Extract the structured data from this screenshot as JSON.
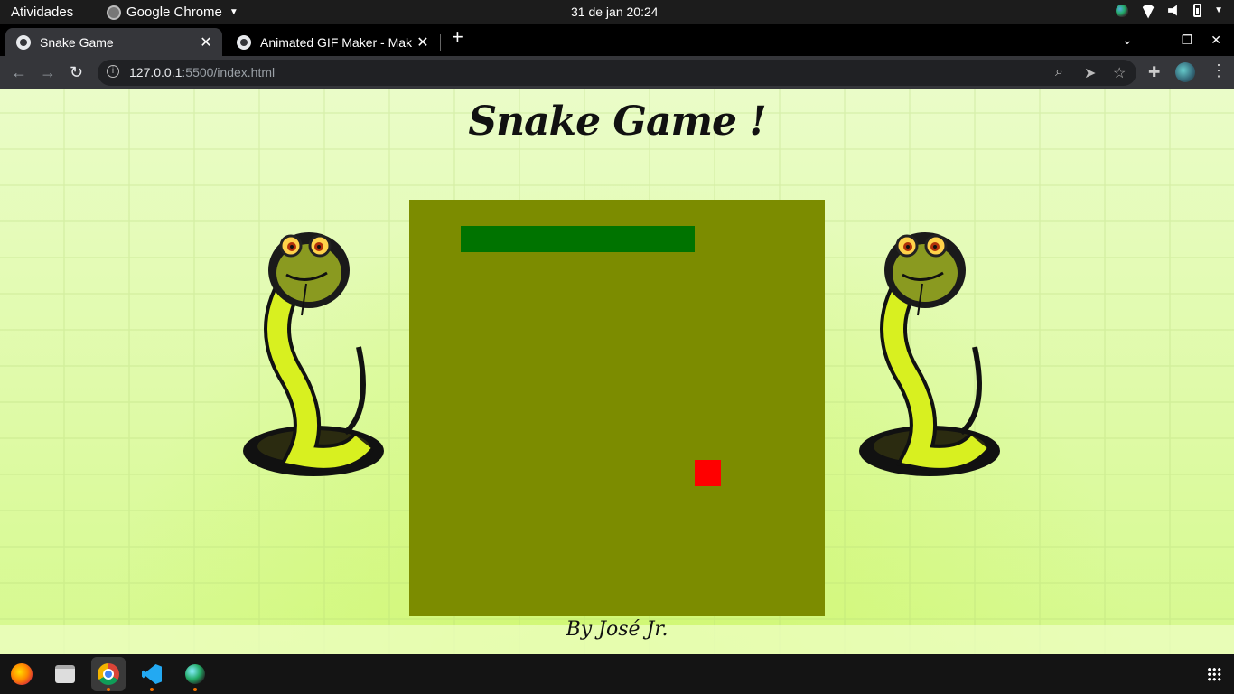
{
  "topbar": {
    "activities": "Atividades",
    "app_name": "Google Chrome",
    "clock": "31 de jan  20:24"
  },
  "tabs": [
    {
      "title": "Snake Game",
      "active": true
    },
    {
      "title": "Animated GIF Maker - Mak",
      "active": false
    }
  ],
  "address_bar": {
    "host": "127.0.0.1",
    "path": ":5500/index.html"
  },
  "page": {
    "heading": "Snake Game !",
    "byline": "By José Jr."
  },
  "game": {
    "board_color": "#7c8c00",
    "snake_color": "#007300",
    "food_color": "#ff0000"
  },
  "dock": {
    "items": [
      "firefox-icon",
      "files-icon",
      "chrome-icon",
      "vscode-icon",
      "globe-icon"
    ]
  }
}
